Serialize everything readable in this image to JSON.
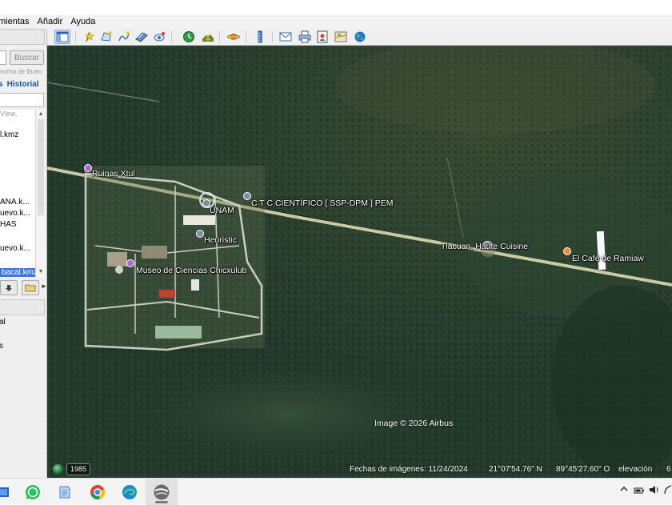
{
  "menu": {
    "items": [
      "mientas",
      "Añadir",
      "Ayuda"
    ]
  },
  "toolbar": {
    "buttons": [
      "sidebar-toggle-icon",
      "placemark-icon",
      "polygon-icon",
      "path-icon",
      "overlay-icon",
      "record-tour-icon",
      "historical-imagery-icon",
      "sunlight-icon",
      "planets-icon",
      "ruler-icon",
      "email-icon",
      "print-icon",
      "save-image-icon",
      "view-in-maps-icon",
      "earth-icon"
    ]
  },
  "sidebar": {
    "search_button": "Buscar",
    "search_hint": "noma de Buen",
    "tabs": [
      "s",
      "Historial"
    ],
    "list_items": [
      {
        "text": "View,",
        "faded": true
      },
      {
        "text": "l.kmz"
      },
      {
        "text": "ANA.k..."
      },
      {
        "text": "uevo.k..."
      },
      {
        "text": "HAS"
      },
      {
        "text": "uevo.k..."
      },
      {
        "text": "bacal.kmz",
        "selected": true
      }
    ],
    "layers": [
      "al",
      "s"
    ]
  },
  "map": {
    "places": [
      {
        "label": "Ruinas Xtul",
        "color": "#b467d4"
      },
      {
        "label": "UNAM",
        "color": "#7f8ea8"
      },
      {
        "label": "C T C CIENTÍFICO [ SSP-DPM ] PEM",
        "color": "#7f8ea8"
      },
      {
        "label": "Heuristic",
        "color": "#7f8ea8"
      },
      {
        "label": "Museo de Ciencias Chicxulub",
        "color": "#b467d4"
      },
      {
        "label": "Tlacuan, Haute Cuisine",
        "color": "#7f8ea8"
      },
      {
        "label": "El Café de Ramiaw",
        "color": "#f08a3c"
      }
    ],
    "credit": "Image © 2026 Airbus",
    "status": {
      "year": "1985",
      "imagery_date": "Fechas de imágenes: 11/24/2024",
      "latitude": "21°07'54.76\" N",
      "longitude": "89°45'27.60\" O",
      "elevation": "elevación",
      "elevation_partial": "6"
    }
  },
  "taskbar": {
    "apps": [
      "file-explorer-icon",
      "whatsapp-icon",
      "notepad-icon",
      "chrome-icon",
      "edge-icon",
      "google-earth-icon"
    ],
    "tray": [
      "chevron-up-icon",
      "battery-icon",
      "volume-icon",
      "wifi-icon"
    ]
  }
}
